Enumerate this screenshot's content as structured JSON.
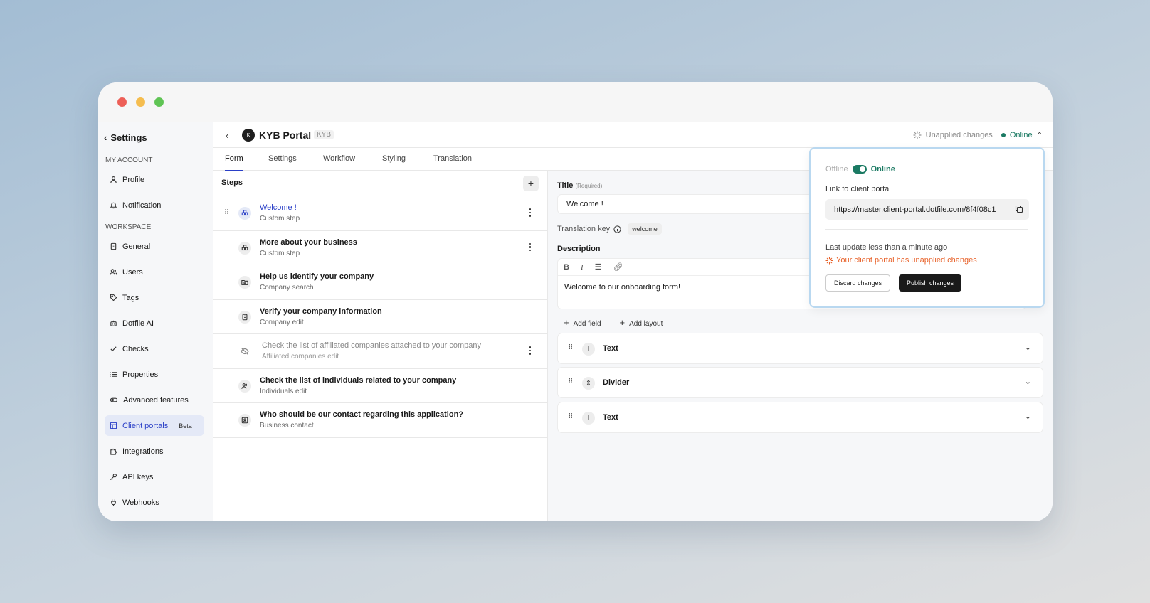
{
  "sidebar": {
    "back_label": "Settings",
    "sections": {
      "account": "MY ACCOUNT",
      "workspace": "WORKSPACE"
    },
    "account_items": [
      {
        "label": "Profile",
        "icon": "user-icon"
      },
      {
        "label": "Notification",
        "icon": "bell-icon"
      }
    ],
    "workspace_items": [
      {
        "label": "General",
        "icon": "building-icon"
      },
      {
        "label": "Users",
        "icon": "users-icon"
      },
      {
        "label": "Tags",
        "icon": "tag-icon"
      },
      {
        "label": "Dotfile AI",
        "icon": "robot-icon"
      },
      {
        "label": "Checks",
        "icon": "check-icon"
      },
      {
        "label": "Properties",
        "icon": "list-icon"
      },
      {
        "label": "Advanced features",
        "icon": "toggle-icon"
      },
      {
        "label": "Client portals",
        "icon": "layout-icon",
        "badge": "Beta",
        "active": true
      },
      {
        "label": "Integrations",
        "icon": "puzzle-icon"
      },
      {
        "label": "API keys",
        "icon": "key-icon"
      },
      {
        "label": "Webhooks",
        "icon": "webhook-icon"
      }
    ]
  },
  "header": {
    "avatar_letter": "K",
    "title": "KYB Portal",
    "tag": "KYB",
    "unapplied": "Unapplied changes",
    "status": "Online"
  },
  "tabs": [
    {
      "label": "Form",
      "active": true
    },
    {
      "label": "Settings"
    },
    {
      "label": "Workflow"
    },
    {
      "label": "Styling"
    },
    {
      "label": "Translation"
    }
  ],
  "steps": {
    "title": "Steps",
    "items": [
      {
        "title": "Welcome !",
        "subtitle": "Custom step",
        "active": true
      },
      {
        "title": "More about your business",
        "subtitle": "Custom step"
      },
      {
        "title": "Help us identify your company",
        "subtitle": "Company search"
      },
      {
        "title": "Verify your company information",
        "subtitle": "Company edit"
      },
      {
        "title": "Check the list of affiliated companies attached to your company",
        "subtitle": "Affiliated companies edit",
        "muted": true
      },
      {
        "title": "Check the list of individuals related to your company",
        "subtitle": "Individuals edit"
      },
      {
        "title": "Who should be our contact regarding this application?",
        "subtitle": "Business contact"
      }
    ]
  },
  "editor": {
    "title_label": "Title",
    "required": "(Required)",
    "title_value": "Welcome !",
    "translation_key_label": "Translation key",
    "translation_key_value": "welcome",
    "description_label": "Description",
    "description_value": "Welcome to our onboarding form!",
    "add_field": "Add field",
    "add_layout": "Add layout",
    "fields": [
      {
        "name": "Text",
        "icon": "text-cursor-icon"
      },
      {
        "name": "Divider",
        "icon": "divider-icon"
      },
      {
        "name": "Text",
        "icon": "text-cursor-icon"
      }
    ]
  },
  "popover": {
    "offline": "Offline",
    "online": "Online",
    "link_label": "Link to client portal",
    "link": "https://master.client-portal.dotfile.com/8f4f08c1",
    "last_update": "Last update less than a minute ago",
    "warning": "Your client portal has unapplied changes",
    "discard": "Discard changes",
    "publish": "Publish changes"
  },
  "colors": {
    "accent": "#2a3fc7",
    "online": "#1b7a63",
    "warning": "#e8622a",
    "close": "#ed5f57",
    "minimize": "#f5bd4f",
    "maximize": "#5fc454"
  }
}
